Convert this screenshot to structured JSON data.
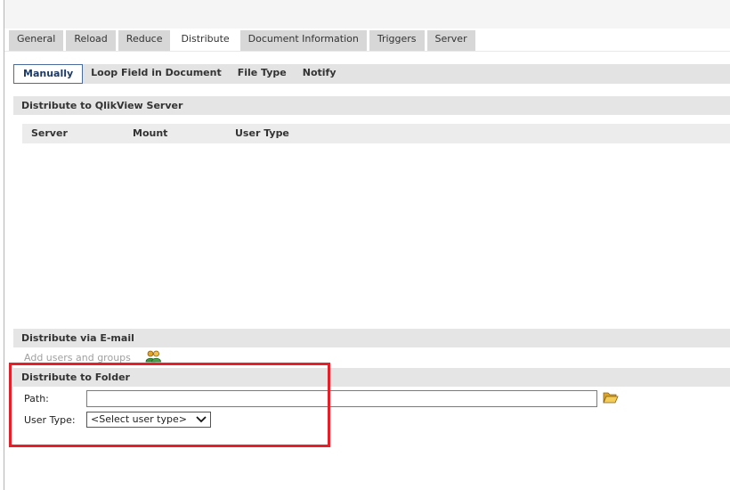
{
  "main_tabs": [
    {
      "label": "General",
      "active": false
    },
    {
      "label": "Reload",
      "active": false
    },
    {
      "label": "Reduce",
      "active": false
    },
    {
      "label": "Distribute",
      "active": true
    },
    {
      "label": "Document Information",
      "active": false
    },
    {
      "label": "Triggers",
      "active": false
    },
    {
      "label": "Server",
      "active": false
    }
  ],
  "sub_tabs": [
    {
      "label": "Manually",
      "active": true
    },
    {
      "label": "Loop Field in Document",
      "active": false
    },
    {
      "label": "File Type",
      "active": false
    },
    {
      "label": "Notify",
      "active": false
    }
  ],
  "sections": {
    "qlikview_server": {
      "title": "Distribute to QlikView Server",
      "columns": [
        "Server",
        "Mount",
        "User Type"
      ]
    },
    "email": {
      "title": "Distribute via E-mail",
      "add_link": "Add users and groups"
    },
    "folder": {
      "title": "Distribute to Folder",
      "path_label": "Path:",
      "path_value": "",
      "user_type_label": "User Type:",
      "user_type_selected": "<Select user type>"
    }
  },
  "icons": {
    "users": "users-group-icon",
    "folder": "folder-open-icon",
    "dropdown": "chevron-down-icon"
  },
  "colors": {
    "highlight": "#e4202b",
    "active_subtab_border": "#4a6c9c"
  }
}
